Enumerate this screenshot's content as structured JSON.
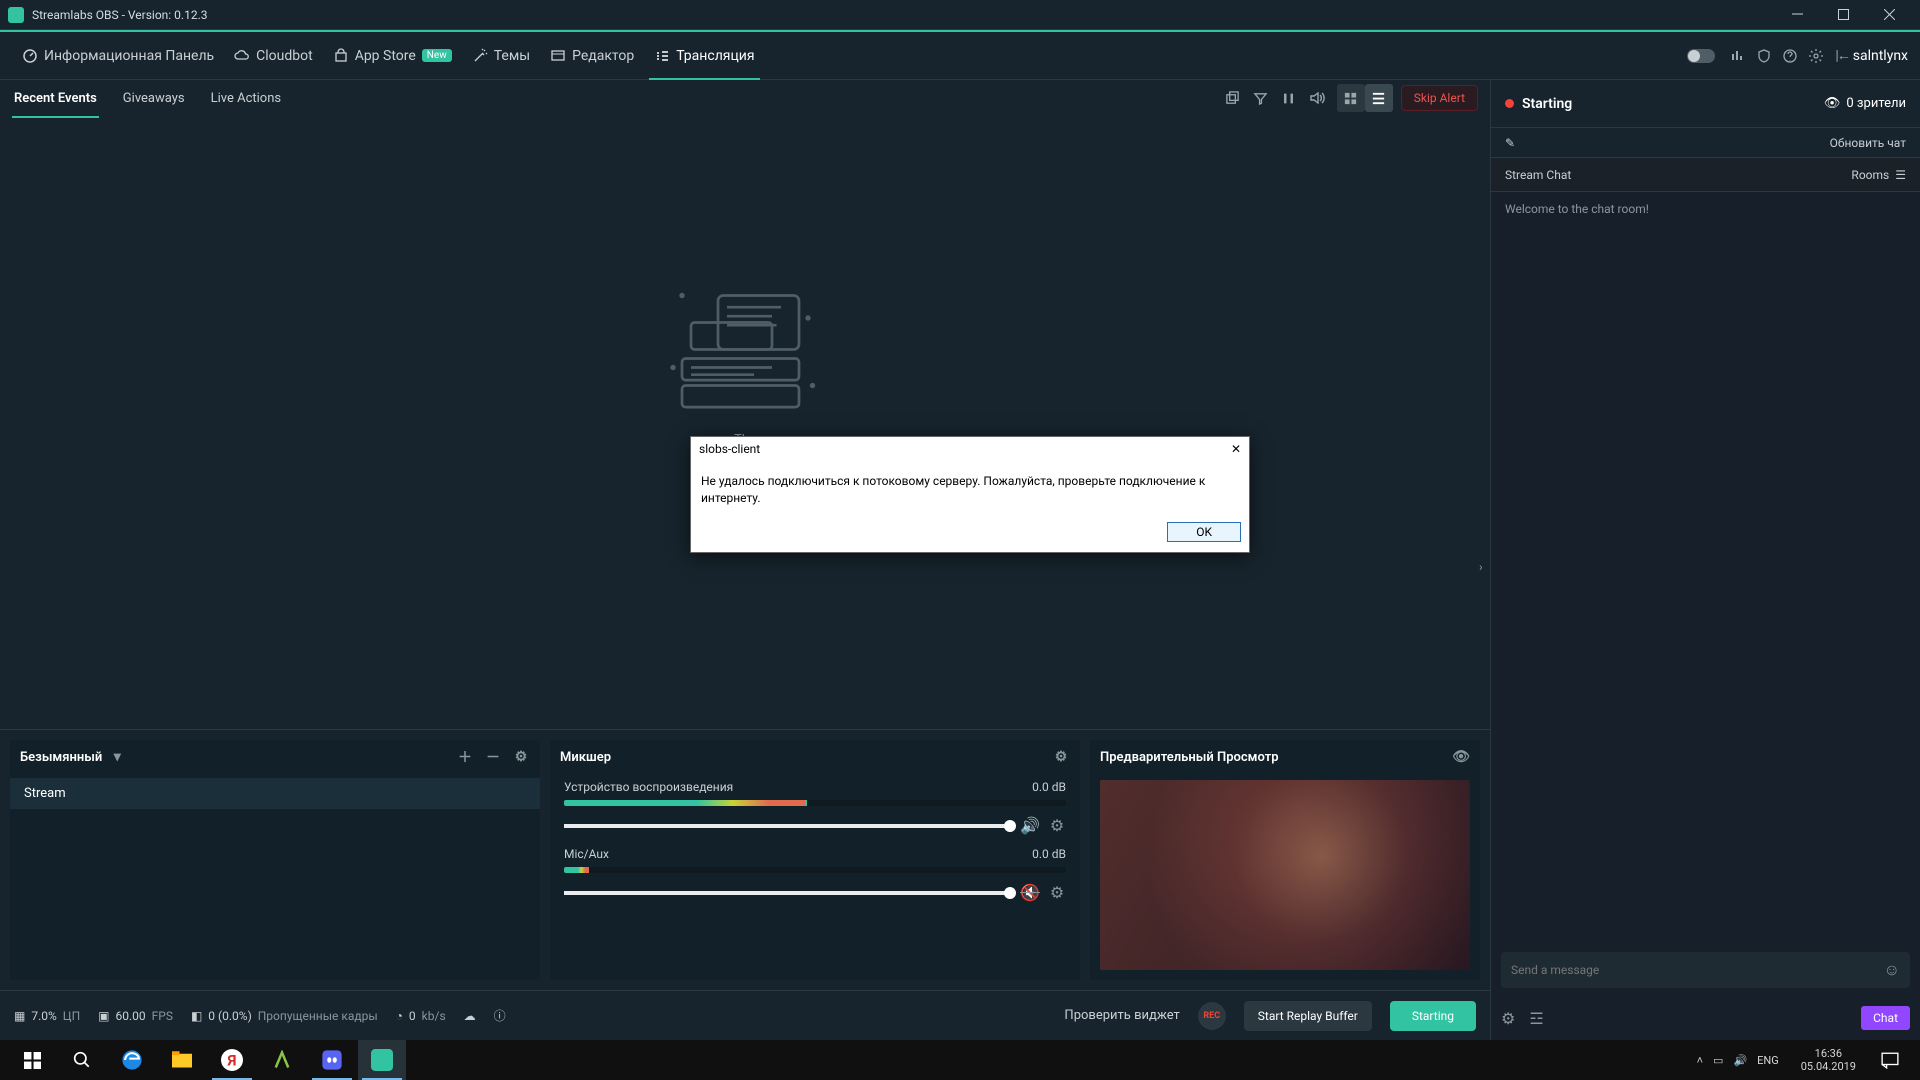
{
  "window": {
    "title": "Streamlabs OBS - Version: 0.12.3"
  },
  "nav": {
    "dashboard": "Информационная Панель",
    "cloudbot": "Cloudbot",
    "appstore": "App Store",
    "appstore_badge": "New",
    "themes": "Темы",
    "editor": "Редактор",
    "live": "Трансляция",
    "username": "salntlynx"
  },
  "events": {
    "tabs": {
      "recent": "Recent Events",
      "giveaways": "Giveaways",
      "live": "Live Actions"
    },
    "skip": "Skip Alert",
    "placeholder": "The"
  },
  "scenes": {
    "title": "Безымянный",
    "row": "Stream"
  },
  "mixer": {
    "title": "Микшер",
    "ch1_name": "Устройство воспроизведения",
    "ch1_db": "0.0 dB",
    "ch2_name": "Mic/Aux",
    "ch2_db": "0.0 dB"
  },
  "preview": {
    "title": "Предварительный Просмотр"
  },
  "chat": {
    "status": "Starting",
    "viewers": "0 зрители",
    "refresh": "Обновить чат",
    "header": "Stream Chat",
    "rooms": "Rooms",
    "welcome": "Welcome to the chat room!",
    "placeholder": "Send a message",
    "send": "Chat"
  },
  "footer": {
    "cpu_v": "7.0%",
    "cpu_l": "ЦП",
    "fps_v": "60.00",
    "fps_l": "FPS",
    "drop_v": "0 (0.0%)",
    "drop_l": "Пропущенные кадры",
    "bitrate_v": "0",
    "bitrate_l": "kb/s",
    "widget": "Проверить виджет",
    "rec": "REC",
    "replay": "Start Replay Buffer",
    "start": "Starting"
  },
  "dialog": {
    "title": "slobs-client",
    "body": "Не удалось подключиться к потоковому серверу. Пожалуйста, проверьте подключение к интернету.",
    "ok": "OK"
  },
  "tray": {
    "lang": "ENG",
    "time": "16:36",
    "date": "05.04.2019"
  }
}
